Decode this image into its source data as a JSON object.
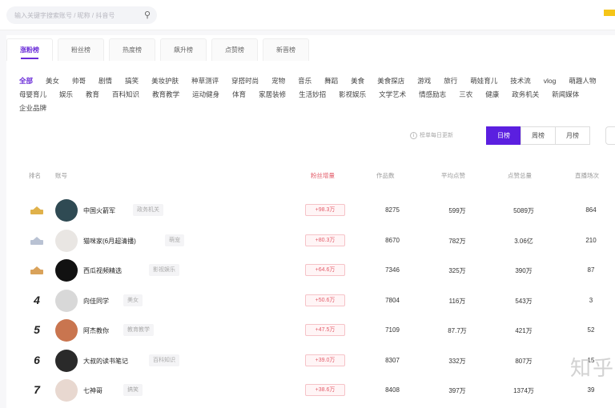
{
  "search": {
    "placeholder": "输入关键字搜索账号 / 昵称 / 抖音号"
  },
  "tabs": [
    "涨粉榜",
    "粉丝榜",
    "热度榜",
    "飙升榜",
    "点赞榜",
    "新晋榜"
  ],
  "categories": [
    "全部",
    "美女",
    "帅哥",
    "剧情",
    "搞笑",
    "美妆护肤",
    "种草测评",
    "穿搭时尚",
    "宠物",
    "音乐",
    "舞蹈",
    "美食",
    "美食探店",
    "游戏",
    "旅行",
    "萌娃育儿",
    "技术流",
    "vlog",
    "萌趣人物",
    "母婴育儿",
    "娱乐",
    "教育",
    "百科知识",
    "教育教学",
    "运动健身",
    "体育",
    "家居装修",
    "生活妙招",
    "影视娱乐",
    "文学艺术",
    "情感励志",
    "三农",
    "健康",
    "政务机关",
    "新闻媒体",
    "企业品牌"
  ],
  "update_note": "榜单每日更新",
  "periods": [
    "日榜",
    "周榜",
    "月榜"
  ],
  "table": {
    "headers": [
      "排名",
      "账号",
      "粉丝增量",
      "作品数",
      "平均点赞",
      "点赞总量",
      "直播场次"
    ],
    "rows": [
      {
        "rank": "1",
        "name": "中国火箭军",
        "tag": "政务机关",
        "increase": "+98.3万",
        "works": "8275",
        "avg_likes": "599万",
        "total_likes": "5089万",
        "live": "864"
      },
      {
        "rank": "2",
        "name": "猫咪家(6月超清播)",
        "tag": "萌宠",
        "increase": "+80.3万",
        "works": "8670",
        "avg_likes": "782万",
        "total_likes": "3.06亿",
        "live": "210"
      },
      {
        "rank": "3",
        "name": "西瓜视频精选",
        "tag": "影视娱乐",
        "increase": "+64.6万",
        "works": "7346",
        "avg_likes": "325万",
        "total_likes": "390万",
        "live": "87"
      },
      {
        "rank": "4",
        "name": "向佳同学",
        "tag": "美女",
        "increase": "+50.6万",
        "works": "7804",
        "avg_likes": "116万",
        "total_likes": "543万",
        "live": "3"
      },
      {
        "rank": "5",
        "name": "阿杰教你",
        "tag": "教育教学",
        "increase": "+47.5万",
        "works": "7109",
        "avg_likes": "87.7万",
        "total_likes": "421万",
        "live": "52"
      },
      {
        "rank": "6",
        "name": "大叔的读书笔记",
        "tag": "百科知识",
        "increase": "+39.0万",
        "works": "8307",
        "avg_likes": "332万",
        "total_likes": "807万",
        "live": "15"
      },
      {
        "rank": "7",
        "name": "七神哥",
        "tag": "搞笑",
        "increase": "+38.6万",
        "works": "8408",
        "avg_likes": "397万",
        "total_likes": "1374万",
        "live": "39"
      }
    ]
  },
  "watermark": "知乎",
  "colors": {
    "accent": "#6a2cd8",
    "increase": "#e35d6a",
    "gold": "#e0b14a",
    "silver": "#b9c2d3",
    "bronze": "#d9a25a"
  }
}
